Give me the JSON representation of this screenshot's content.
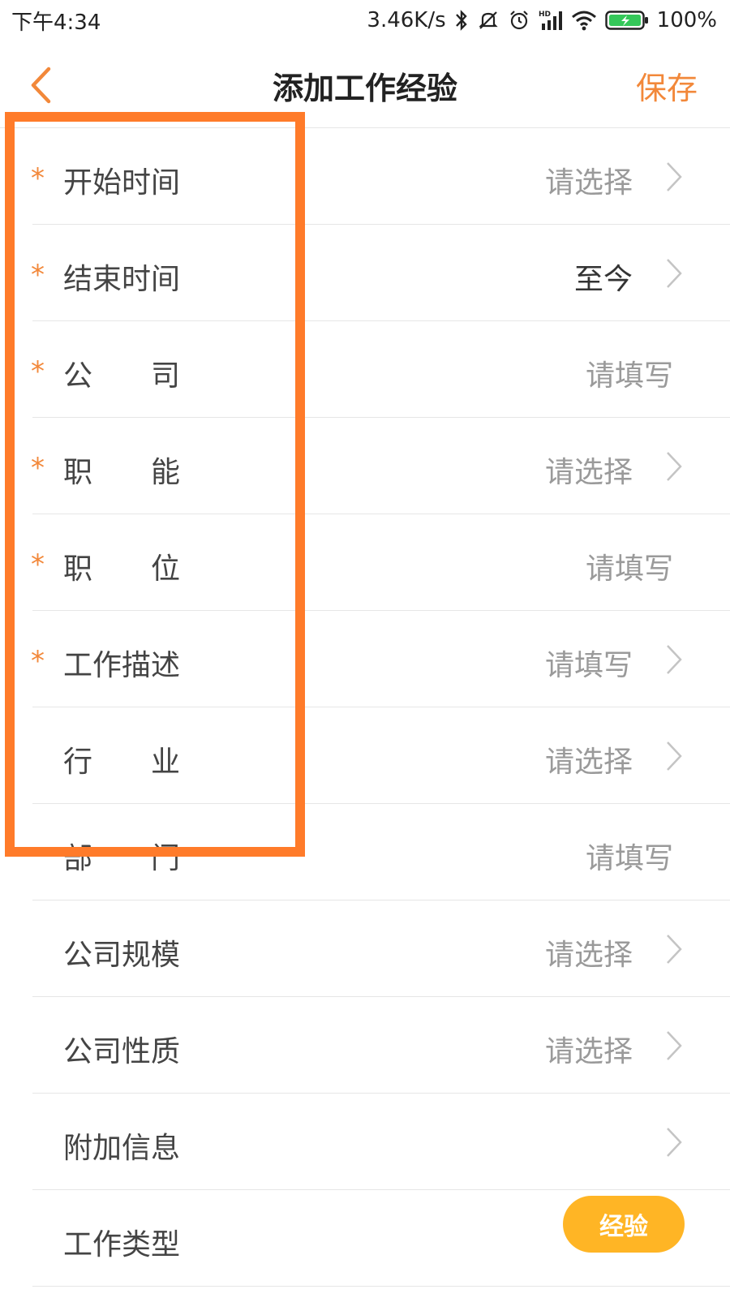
{
  "status_bar": {
    "time": "下午4:34",
    "net_speed": "3.46K/s",
    "battery": "100%",
    "icons": [
      "bluetooth-icon",
      "mute-bell-icon",
      "alarm-icon",
      "signal-hd-icon",
      "wifi-icon",
      "battery-charging-icon"
    ]
  },
  "nav": {
    "back_icon": "back-chevron-icon",
    "title": "添加工作经验",
    "save": "保存"
  },
  "form": {
    "rows": [
      {
        "required": "*",
        "label": "开始时间",
        "value": "请选择",
        "arrow": true
      },
      {
        "required": "*",
        "label": "结束时间",
        "value": "至今",
        "arrow": true
      },
      {
        "required": "*",
        "label": "公　　司",
        "value": "请填写",
        "arrow": false
      },
      {
        "required": "*",
        "label": "职　　能",
        "value": "请选择",
        "arrow": true
      },
      {
        "required": "*",
        "label": "职　　位",
        "value": "请填写",
        "arrow": false
      },
      {
        "required": "*",
        "label": "工作描述",
        "value": "请填写",
        "arrow": true
      },
      {
        "required": "",
        "label": "行　　业",
        "value": "请选择",
        "arrow": true
      },
      {
        "required": "",
        "label": "部　　门",
        "value": "请填写",
        "arrow": false
      },
      {
        "required": "",
        "label": "公司规模",
        "value": "请选择",
        "arrow": true
      },
      {
        "required": "",
        "label": "公司性质",
        "value": "请选择",
        "arrow": true
      },
      {
        "required": "",
        "label": "附加信息",
        "value": "",
        "arrow": true
      },
      {
        "required": "",
        "label": "工作类型",
        "value": "",
        "arrow": false
      }
    ]
  },
  "colors": {
    "accent": "#f2883a",
    "highlight": "#ff7b2a"
  }
}
